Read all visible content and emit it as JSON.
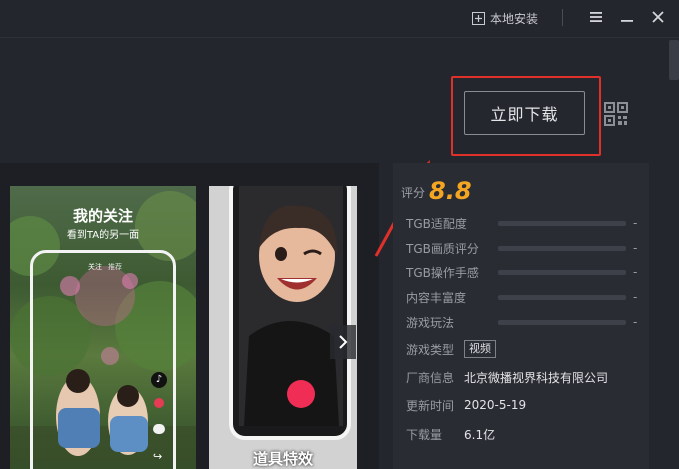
{
  "titlebar": {
    "local_install_label": "本地安装",
    "menu_icon": "hamburger-menu-icon",
    "minimize_icon": "minimize-icon",
    "close_icon": "close-icon"
  },
  "download": {
    "button_label": "立即下载",
    "qr_icon": "qr-code-icon",
    "highlight_color": "#e0302a"
  },
  "gallery": {
    "screenshots": [
      {
        "title": "我的关注",
        "subtitle": "看到TA的另一面",
        "tab_follow": "关注",
        "tab_recommend": "推荐"
      },
      {
        "title": "道具特效"
      }
    ],
    "next_icon": "chevron-right-icon"
  },
  "info": {
    "score_label": "评分",
    "score": "8.8",
    "ratings": [
      {
        "label": "TGB适配度",
        "value": "-"
      },
      {
        "label": "TGB画质评分",
        "value": "-"
      },
      {
        "label": "TGB操作手感",
        "value": "-"
      },
      {
        "label": "内容丰富度",
        "value": "-"
      },
      {
        "label": "游戏玩法",
        "value": "-"
      }
    ],
    "game_type_label": "游戏类型",
    "game_type_tag": "视频",
    "developer_label": "厂商信息",
    "developer": "北京微播视界科技有限公司",
    "updated_label": "更新时间",
    "updated": "2020-5-19",
    "downloads_label": "下载量",
    "downloads": "6.1亿"
  },
  "colors": {
    "background": "#24262d",
    "panel": "#2a2c33",
    "score": "#f4a623"
  }
}
